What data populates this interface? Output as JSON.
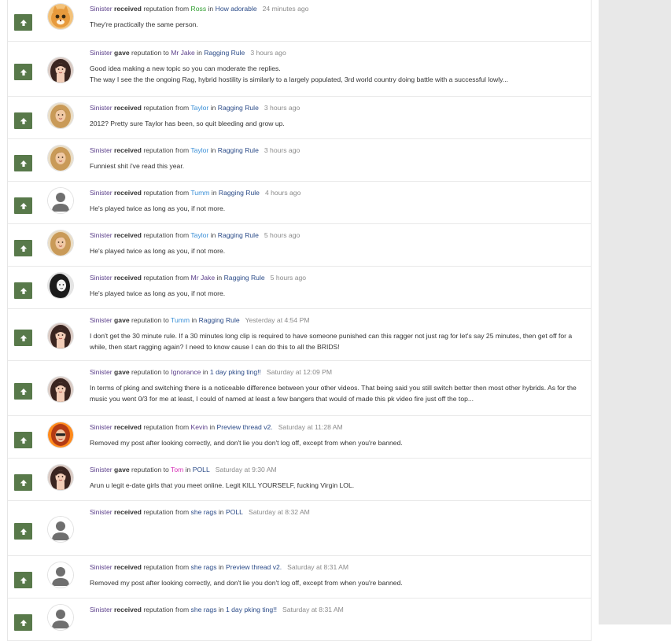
{
  "colors": {
    "upvote_button": "#58794a",
    "user_link": "#5b3f8a",
    "topic_link": "#2b4b88",
    "timestamp": "#8a8a8a",
    "side_panel": "#e8e8e8"
  },
  "items": [
    {
      "user": "Sinister",
      "verb": "received",
      "mid": "reputation from",
      "other_user": "Ross",
      "other_color": "#2e9e2e",
      "in_text": "in",
      "topic": "How adorable",
      "time": "24 minutes ago",
      "body": [
        "They're practically the same person."
      ],
      "avatar_icon": "cat-face-avatar-icon",
      "avatar_kind": "cat"
    },
    {
      "user": "Sinister",
      "verb": "gave",
      "mid": "reputation to",
      "other_user": "Mr Jake",
      "other_color": "#5b3f8a",
      "in_text": "in",
      "topic": "Ragging Rule",
      "time": "3 hours ago",
      "body": [
        "Good idea making a new topic so you can moderate the replies.",
        "The way I see the the ongoing Rag, hybrid hostility is similarly to a largely populated, 3rd world country doing battle with a successful lowly..."
      ],
      "avatar_icon": "dark-hair-woman-avatar-icon",
      "avatar_kind": "dark"
    },
    {
      "user": "Sinister",
      "verb": "received",
      "mid": "reputation from",
      "other_user": "Taylor",
      "other_color": "#3a8fd6",
      "in_text": "in",
      "topic": "Ragging Rule",
      "time": "3 hours ago",
      "body": [
        "2012? Pretty sure Taylor has been, so quit bleeding and grow up."
      ],
      "avatar_icon": "blonde-woman-avatar-icon",
      "avatar_kind": "blonde"
    },
    {
      "user": "Sinister",
      "verb": "received",
      "mid": "reputation from",
      "other_user": "Taylor",
      "other_color": "#3a8fd6",
      "in_text": "in",
      "topic": "Ragging Rule",
      "time": "3 hours ago",
      "body": [
        "Funniest shit i've read this year."
      ],
      "avatar_icon": "blonde-woman-avatar-icon",
      "avatar_kind": "blonde"
    },
    {
      "user": "Sinister",
      "verb": "received",
      "mid": "reputation from",
      "other_user": "Tumm",
      "other_color": "#3a8fd6",
      "in_text": "in",
      "topic": "Ragging Rule",
      "time": "4 hours ago",
      "body": [
        "He's played twice as long as you, if not more."
      ],
      "avatar_icon": "default-user-avatar-icon",
      "avatar_kind": "default"
    },
    {
      "user": "Sinister",
      "verb": "received",
      "mid": "reputation from",
      "other_user": "Taylor",
      "other_color": "#3a8fd6",
      "in_text": "in",
      "topic": "Ragging Rule",
      "time": "5 hours ago",
      "body": [
        "He's played twice as long as you, if not more."
      ],
      "avatar_icon": "blonde-woman-avatar-icon",
      "avatar_kind": "blonde"
    },
    {
      "user": "Sinister",
      "verb": "received",
      "mid": "reputation from",
      "other_user": "Mr Jake",
      "other_color": "#5b3f8a",
      "in_text": "in",
      "topic": "Ragging Rule",
      "time": "5 hours ago",
      "body": [
        "He's played twice as long as you, if not more."
      ],
      "avatar_icon": "monochrome-woman-avatar-icon",
      "avatar_kind": "mono"
    },
    {
      "user": "Sinister",
      "verb": "gave",
      "mid": "reputation to",
      "other_user": "Tumm",
      "other_color": "#3a8fd6",
      "in_text": "in",
      "topic": "Ragging Rule",
      "time": "Yesterday at 4:54 PM",
      "body": [
        "I don't get the 30 minute rule. If a 30 minutes long clip is required to have someone punished can this ragger not just rag for let's say 25 minutes, then get off for a while, then start ragging again? I need to know cause I can do this to all the BRIDS!"
      ],
      "avatar_icon": "dark-hair-woman-avatar-icon",
      "avatar_kind": "dark"
    },
    {
      "user": "Sinister",
      "verb": "gave",
      "mid": "reputation to",
      "other_user": "Ignorance",
      "other_color": "#5b3f8a",
      "in_text": "in",
      "topic": "1 day pking ting!!",
      "time": "Saturday at 12:09 PM",
      "body": [
        "In terms of pking and switching there is a noticeable difference between your other videos. That being said you still switch better then most other hybrids. As for the music you went 0/3 for me at least, I could of named at least a few bangers that would of made this pk video fire just off the top..."
      ],
      "avatar_icon": "dark-hair-woman-avatar-icon",
      "avatar_kind": "dark"
    },
    {
      "user": "Sinister",
      "verb": "received",
      "mid": "reputation from",
      "other_user": "Kevin",
      "other_color": "#5b3f8a",
      "in_text": "in",
      "topic": "Preview thread v2.",
      "time": "Saturday at 11:28 AM",
      "body": [
        "Removed my post after looking correctly, and don't lie you don't log off, except from when you're banned."
      ],
      "avatar_icon": "red-hair-avatar-icon",
      "avatar_kind": "red"
    },
    {
      "user": "Sinister",
      "verb": "gave",
      "mid": "reputation to",
      "other_user": "Tom",
      "other_color": "#d62fb6",
      "in_text": "in",
      "topic": "POLL",
      "time": "Saturday at 9:30 AM",
      "body": [
        "Arun u legit e-date girls that you meet online. Legit KILL YOURSELF, fucking Virgin LOL."
      ],
      "avatar_icon": "dark-hair-woman-avatar-icon",
      "avatar_kind": "dark"
    },
    {
      "user": "Sinister",
      "verb": "received",
      "mid": "reputation from",
      "other_user": "she rags",
      "other_color": "#2b4b88",
      "in_text": "in",
      "topic": "POLL",
      "time": "Saturday at 8:32 AM",
      "body": [],
      "avatar_icon": "default-user-avatar-icon",
      "avatar_kind": "default"
    },
    {
      "user": "Sinister",
      "verb": "received",
      "mid": "reputation from",
      "other_user": "she rags",
      "other_color": "#2b4b88",
      "in_text": "in",
      "topic": "Preview thread v2.",
      "time": "Saturday at 8:31 AM",
      "body": [
        "Removed my post after looking correctly, and don't lie you don't log off, except from when you're banned."
      ],
      "avatar_icon": "default-user-avatar-icon",
      "avatar_kind": "default"
    },
    {
      "user": "Sinister",
      "verb": "received",
      "mid": "reputation from",
      "other_user": "she rags",
      "other_color": "#2b4b88",
      "in_text": "in",
      "topic": "1 day pking ting!!",
      "time": "Saturday at 8:31 AM",
      "body": [],
      "avatar_icon": "default-user-avatar-icon",
      "avatar_kind": "default"
    }
  ]
}
